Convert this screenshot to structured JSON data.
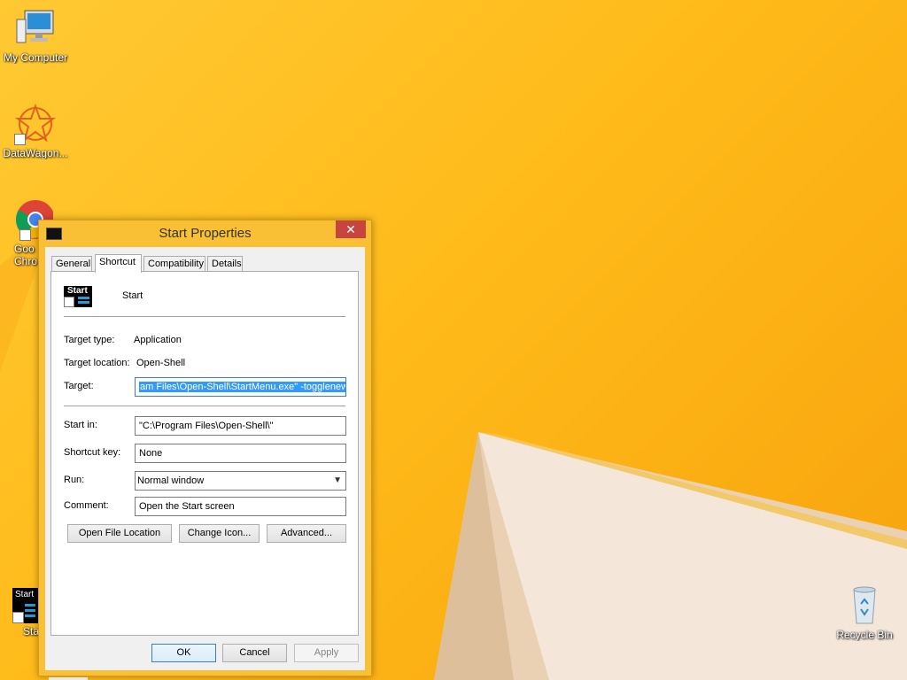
{
  "desktop": {
    "icons": [
      {
        "label": "My Computer"
      },
      {
        "label": "DataWagon..."
      },
      {
        "label": "Goo",
        "label2": "Chro"
      },
      {
        "label": "Sta",
        "icon_text": "Start"
      },
      {
        "label": "Recycle Bin"
      }
    ]
  },
  "window": {
    "title": "Start Properties",
    "close_glyph": "✕",
    "tabs": [
      "General",
      "Shortcut",
      "Compatibility",
      "Details"
    ],
    "active_tab": "Shortcut",
    "app_icon_text": "Start",
    "app_name": "Start",
    "target_type_label": "Target type:",
    "target_type_value": "Application",
    "target_location_label": "Target location:",
    "target_location_value": "Open-Shell",
    "target_label": "Target:",
    "target_value": "am Files\\Open-Shell\\StartMenu.exe\" -togglenew",
    "start_in_label": "Start in:",
    "start_in_value": "\"C:\\Program Files\\Open-Shell\\\"",
    "shortcut_key_label": "Shortcut key:",
    "shortcut_key_value": "None",
    "run_label": "Run:",
    "run_value": "Normal window",
    "comment_label": "Comment:",
    "comment_value": "Open the Start screen",
    "open_file_location": "Open File Location",
    "change_icon": "Change Icon...",
    "advanced": "Advanced...",
    "ok": "OK",
    "cancel": "Cancel",
    "apply": "Apply"
  },
  "colors": {
    "wallpaper": "#ffbb1a",
    "window_frame": "#f9bf35",
    "close_button": "#c7443f",
    "selection": "#3399ff"
  }
}
